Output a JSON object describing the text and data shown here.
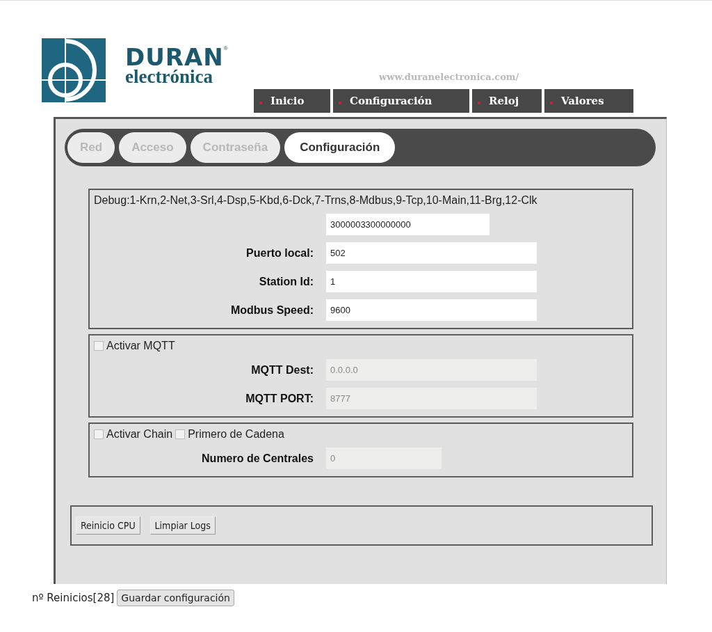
{
  "logo": {
    "name": "DURAN",
    "registered": "®",
    "tagline": "electrónica"
  },
  "site_url": "www.duranelectronica.com/",
  "nav": [
    {
      "label": "Inicio"
    },
    {
      "label": "Configuración"
    },
    {
      "label": "Reloj"
    },
    {
      "label": "Valores"
    }
  ],
  "tabs": [
    {
      "label": "Red",
      "selected": false
    },
    {
      "label": "Acceso",
      "selected": false
    },
    {
      "label": "Contraseña",
      "selected": false
    },
    {
      "label": "Configuración",
      "selected": true
    }
  ],
  "sections": [
    {
      "note": "Debug:1-Krn,2-Net,3-Srl,4-Dsp,5-Kbd,6-Dck,7-Trns,8-Mdbus,9-Tcp,10-Main,11-Brg,12-Clk",
      "fields": [
        {
          "value": "3000003300000000",
          "disabled": false
        },
        {
          "label": "Puerto local:",
          "value": "502",
          "disabled": false
        },
        {
          "label": "Station Id:",
          "value": "1",
          "disabled": false
        },
        {
          "label": "Modbus Speed:",
          "value": "9600",
          "disabled": false
        }
      ]
    },
    {
      "checkboxes": [
        {
          "label": "Activar MQTT",
          "checked": false
        }
      ],
      "fields": [
        {
          "label": "MQTT Dest:",
          "value": "0.0.0.0",
          "disabled": true
        },
        {
          "label": "MQTT PORT:",
          "value": "8777",
          "disabled": true
        }
      ]
    },
    {
      "checkboxes": [
        {
          "label": "Activar Chain",
          "checked": false
        },
        {
          "label": "Primero de Cadena",
          "checked": false
        }
      ],
      "fields": [
        {
          "label": "Numero de Centrales",
          "value": "0",
          "disabled": true
        }
      ]
    }
  ],
  "actions": [
    "Reinicio CPU",
    "Limpiar Logs"
  ],
  "footer": {
    "restarts": "nº Reinicios[28]",
    "save": "Guardar configuración"
  }
}
